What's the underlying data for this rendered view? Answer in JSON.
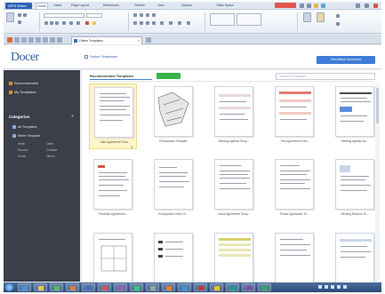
{
  "menubar": {
    "app_label": "WPS Writer",
    "tabs": [
      "Home",
      "Insert",
      "Page Layout",
      "References",
      "Review",
      "View",
      "Section",
      "Office Space"
    ]
  },
  "tabstrip": {
    "doc_tab_label": "Online Templates",
    "close_glyph": "×"
  },
  "header": {
    "logo_text": "Docer",
    "title": "Online Templates",
    "new_button_label": "New Blank Document"
  },
  "sidebar": {
    "recommended_label": "Recommended",
    "my_templates_label": "My Templates",
    "categories_title": "Categories",
    "plus_glyph": "+",
    "all_templates_label": "All Templates",
    "writer_templates_label": "Writer Template",
    "sub_items": [
      "Writer",
      "Letter",
      "Resume",
      "Contract",
      "Forms",
      "Others"
    ]
  },
  "main": {
    "section_title": "Recommended Templates",
    "search_placeholder": "Search for templates",
    "card_labels": [
      "Gate Agreement Form",
      "Presentation Template",
      "Meeting Agenda Temp...",
      "Fee Agreement Form",
      "Meeting Agenda for...",
      "Purchase Agreement...",
      "Employment Letter Te...",
      "Lease Agreement Temp...",
      "Rental Application Te...",
      "Meeting Resume Te...",
      "",
      "",
      "",
      "",
      ""
    ],
    "star_glyph": "★"
  },
  "colors": {
    "accent": "#3f7cd8",
    "sidebar_bg": "#3b3f4a",
    "selected_card": "#fff6c6",
    "new_badge": "#38b349"
  }
}
